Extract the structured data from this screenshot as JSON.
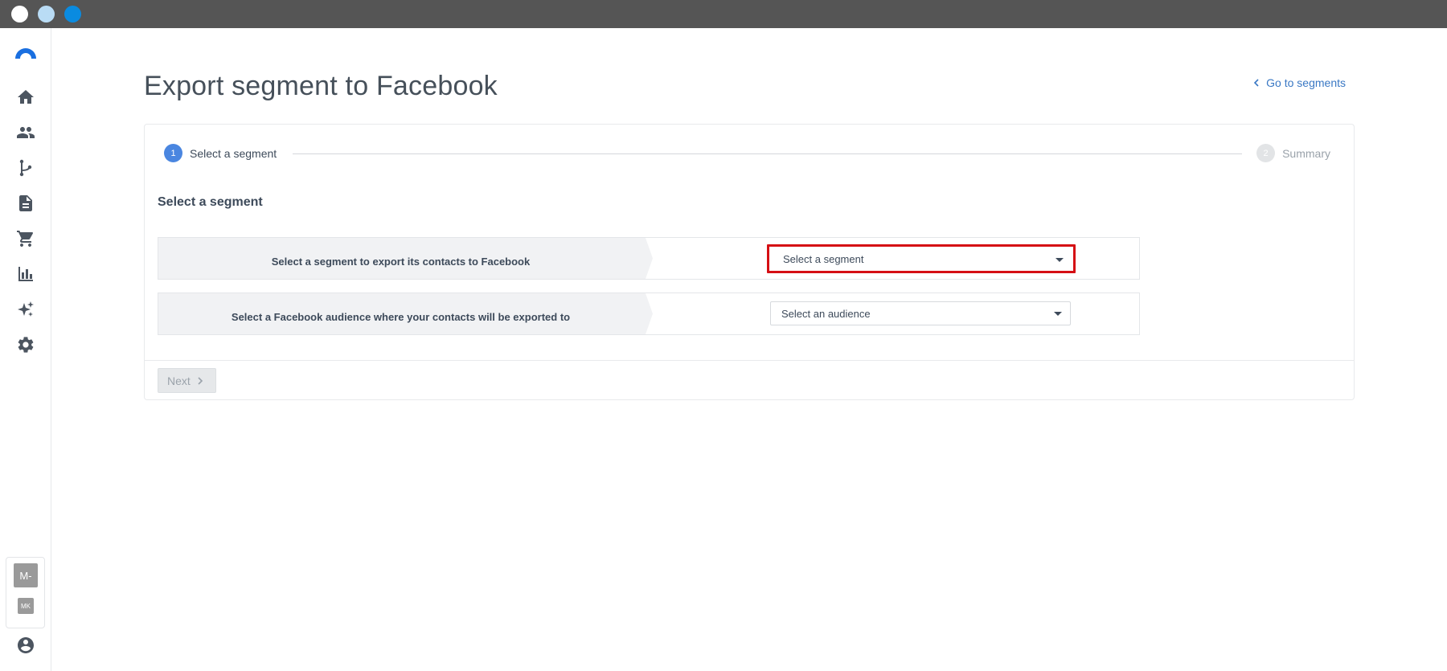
{
  "window": {
    "controls": [
      "close",
      "minimize",
      "maximize"
    ]
  },
  "sidebar": {
    "items": [
      {
        "name": "home",
        "icon": "home-icon"
      },
      {
        "name": "contacts",
        "icon": "people-icon"
      },
      {
        "name": "automations",
        "icon": "flow-icon"
      },
      {
        "name": "content",
        "icon": "document-icon"
      },
      {
        "name": "ecommerce",
        "icon": "cart-icon"
      },
      {
        "name": "reports",
        "icon": "bar-chart-icon"
      },
      {
        "name": "ai",
        "icon": "sparkle-icon"
      },
      {
        "name": "settings",
        "icon": "gear-icon"
      }
    ],
    "account": {
      "primary_initials": "M-",
      "secondary_initials": "MK"
    }
  },
  "header": {
    "title": "Export segment to Facebook",
    "back_link": "Go to segments"
  },
  "stepper": {
    "steps": [
      {
        "number": "1",
        "label": "Select a segment",
        "active": true
      },
      {
        "number": "2",
        "label": "Summary",
        "active": false
      }
    ]
  },
  "form": {
    "section_title": "Select a segment",
    "rows": [
      {
        "label": "Select a segment to export its contacts to Facebook",
        "select_value": "Select a segment"
      },
      {
        "label": "Select a Facebook audience where your contacts will be exported to",
        "select_value": "Select an audience"
      }
    ]
  },
  "footer": {
    "next_label": "Next"
  },
  "colors": {
    "accent": "#3a78c4",
    "step_active": "#4a86e0",
    "highlight": "#d50f14",
    "titlebar": "#555555"
  }
}
